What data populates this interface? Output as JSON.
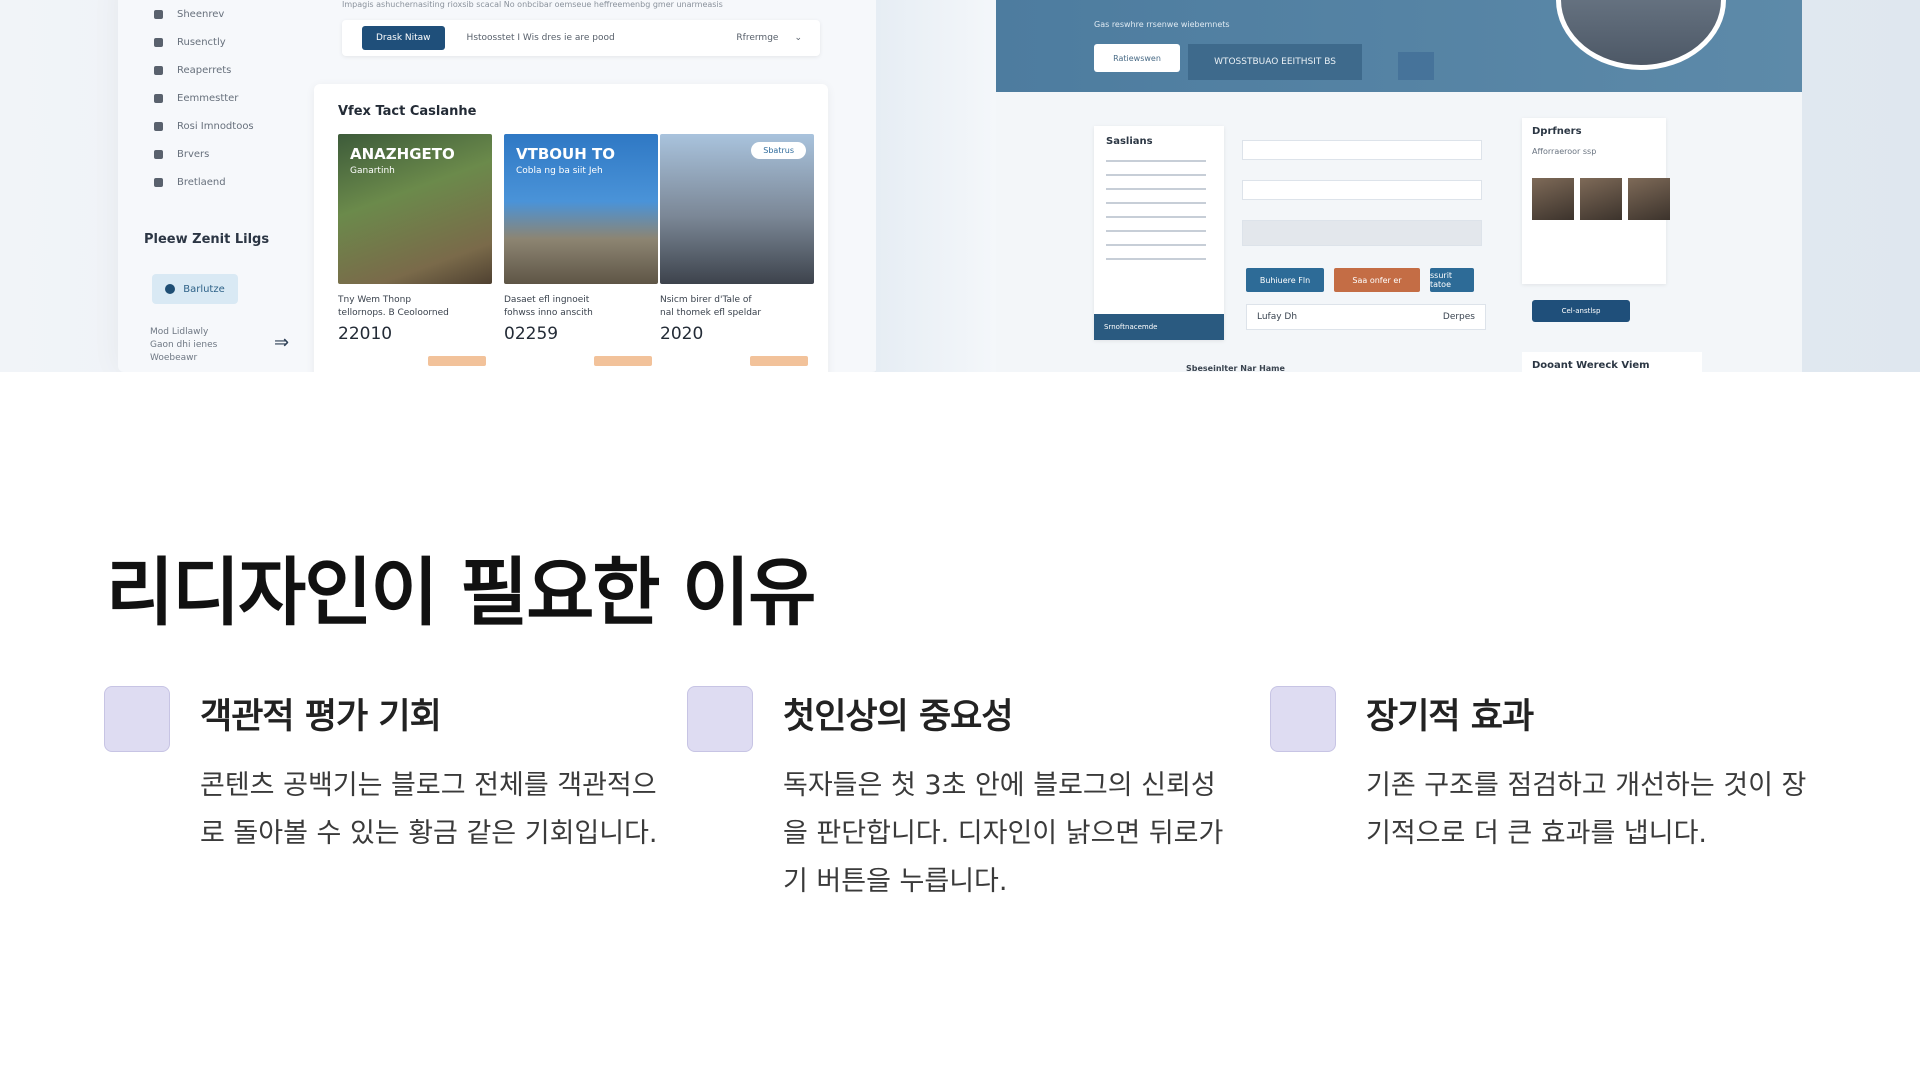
{
  "hero": {
    "left": {
      "strip_text": "Impagis ashuchernasiting rioxsib scacal No onbcibar oemseue heffreemenbg gmer unarmeasis",
      "nav_items": [
        "Sheenrev",
        "Rusenctly",
        "Reaperrets",
        "Eemmestter",
        "Rosi Imnodtoos",
        "Brvers",
        "Bretlaend"
      ],
      "section_label": "Pleew Zenit Lilgs",
      "pill_label": "Barlutze",
      "meta_lines": [
        "Mod Lidlawly",
        "Gaon dhi ienes",
        "Woebeawr"
      ],
      "search_button": "Drask Nitaw",
      "search_text": "Hstoosstet I Wis dres ie are pood",
      "sort_label": "Rfrermge",
      "gallery_title": "Vfex Tact Caslanhe",
      "cards": [
        {
          "overlay": "ANAZHGETO",
          "overlay_sub": "Ganartinh",
          "caption1": "Tny Wem Thonp",
          "caption2": "tellornops. B Ceoloorned",
          "number": "22010"
        },
        {
          "overlay": "VTBOUH TO",
          "overlay_sub": "Cobla ng ba siit Jeh",
          "caption1": "Dasaet efl ingnoeit",
          "caption2": "fohwss inno anscith",
          "number": "02259"
        },
        {
          "overlay": "",
          "overlay_sub": "",
          "tag": "Sbatrus",
          "caption1": "Nsicm birer d'Tale of",
          "caption2": "nal thomek efl speldar",
          "number": "2020"
        }
      ]
    },
    "right": {
      "header_line": "Gas reswhre rrsenwe wiebemnets",
      "header_button": "Ratiewswen",
      "header_field": "WTOSSTBUAO EEITHSIT BS",
      "settings_title": "Saslians",
      "settings_footer": "Srnoftnacemde",
      "buttons": [
        "Buhiuere Fln",
        "Saa onfer er",
        "ssurit tatoe"
      ],
      "row_left": "Lufay Dh",
      "row_right": "Derpes",
      "partners_title": "Dprfners",
      "partners_sub": "Afforraeroor ssp",
      "cta": "Cel-anstlsp",
      "footer_card": "Dooant Wereck Viem",
      "footer_mid": "Sbeseinlter Nar Hame"
    }
  },
  "main": {
    "title": "리디자인이 필요한 이유",
    "reasons": [
      {
        "title": "객관적 평가 기회",
        "body": "콘텐츠 공백기는 블로그 전체를 객관적으로 돌아볼 수 있는 황금 같은 기회입니다."
      },
      {
        "title": "첫인상의 중요성",
        "body": "독자들은 첫 3초 안에 블로그의 신뢰성을 판단합니다. 디자인이 낡으면 뒤로가기 버튼을 누릅니다."
      },
      {
        "title": "장기적 효과",
        "body": "기존 구조를 점검하고 개선하는 것이 장기적으로 더 큰 효과를 냅니다."
      }
    ]
  },
  "colors": {
    "icon_box": "#dedcf2",
    "hero_blue": "#4d7c9f",
    "accent_orange": "#c46d45"
  }
}
